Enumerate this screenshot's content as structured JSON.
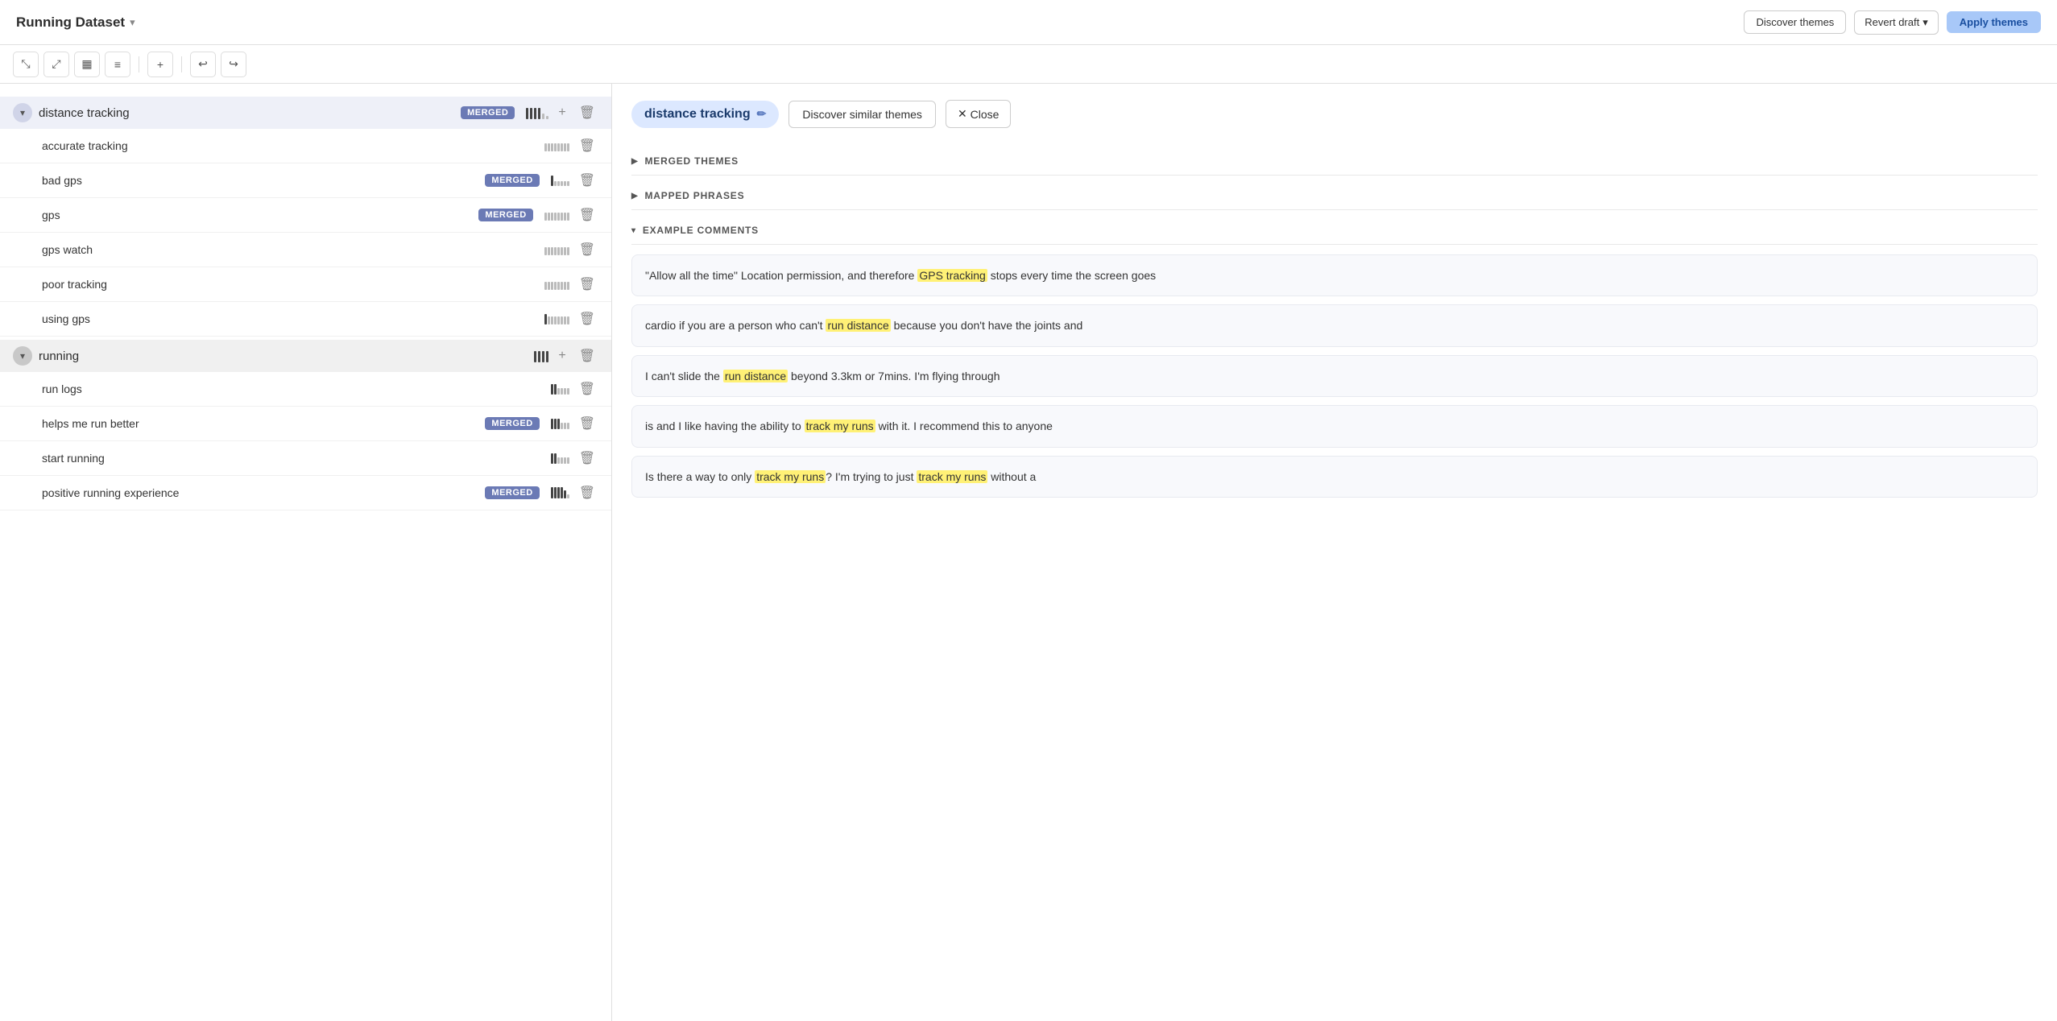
{
  "header": {
    "title": "Running Dataset",
    "discover_themes_label": "Discover themes",
    "revert_draft_label": "Revert draft",
    "apply_themes_label": "Apply themes"
  },
  "toolbar": {
    "icons": [
      "↙↗",
      "↖↗",
      "📊",
      "≡↓",
      "+",
      "↩",
      "↪"
    ]
  },
  "left_panel": {
    "groups": [
      {
        "id": "distance-tracking",
        "name": "distance tracking",
        "merged": true,
        "bars": [
          4,
          4,
          4,
          4,
          2,
          1
        ],
        "sub_items": [
          {
            "name": "accurate tracking",
            "merged": false,
            "bars": [
              1,
              1,
              1,
              1,
              1,
              1,
              1,
              1
            ]
          },
          {
            "name": "bad gps",
            "merged": true,
            "bars": [
              4,
              1,
              1,
              1,
              1,
              1
            ]
          },
          {
            "name": "gps",
            "merged": true,
            "bars": [
              1,
              1,
              1,
              1,
              1,
              1,
              1,
              1
            ]
          },
          {
            "name": "gps watch",
            "merged": false,
            "bars": [
              1,
              1,
              1,
              1,
              1,
              1,
              1,
              1
            ]
          },
          {
            "name": "poor tracking",
            "merged": false,
            "bars": [
              1,
              1,
              1,
              1,
              1,
              1,
              1,
              1
            ]
          },
          {
            "name": "using gps",
            "merged": false,
            "bars": [
              3,
              1,
              1,
              1,
              1,
              1,
              1,
              1
            ]
          }
        ]
      },
      {
        "id": "running",
        "name": "running",
        "merged": false,
        "bars": [
          4,
          4,
          4,
          4
        ],
        "sub_items": [
          {
            "name": "run logs",
            "merged": false,
            "bars": [
              2,
              2,
              1,
              1,
              1,
              1
            ]
          },
          {
            "name": "helps me run better",
            "merged": true,
            "bars": [
              3,
              3,
              3,
              1,
              1,
              1
            ]
          },
          {
            "name": "start running",
            "merged": false,
            "bars": [
              2,
              2,
              1,
              1,
              1,
              1
            ]
          },
          {
            "name": "positive running experience",
            "merged": true,
            "bars": [
              4,
              4,
              4,
              4,
              3,
              1
            ]
          }
        ]
      }
    ]
  },
  "right_panel": {
    "selected_theme": "distance tracking",
    "discover_similar_label": "Discover similar themes",
    "close_label": "Close",
    "sections": {
      "merged_themes": "MERGED THEMES",
      "mapped_phrases": "MAPPED PHRASES",
      "example_comments": "EXAMPLE COMMENTS"
    },
    "comments": [
      {
        "text_before": "\"Allow all the time\" Location permission, and therefore ",
        "highlight": "GPS tracking",
        "text_after": " stops every time the screen goes"
      },
      {
        "text_before": "cardio if you are a person who can't ",
        "highlight": "run distance",
        "text_after": " because you don't have the joints and"
      },
      {
        "text_before": "I can't slide the ",
        "highlight": "run distance",
        "text_after": " beyond 3.3km or 7mins. I'm flying through"
      },
      {
        "text_before": "is and I like having the ability to ",
        "highlight": "track my runs",
        "text_after": " with it. I recommend this to anyone"
      },
      {
        "text_before": "Is there a way to only ",
        "highlight": "track my runs",
        "text_middle": "? I'm trying to just ",
        "highlight2": "track my runs",
        "text_after": " without a"
      }
    ]
  }
}
